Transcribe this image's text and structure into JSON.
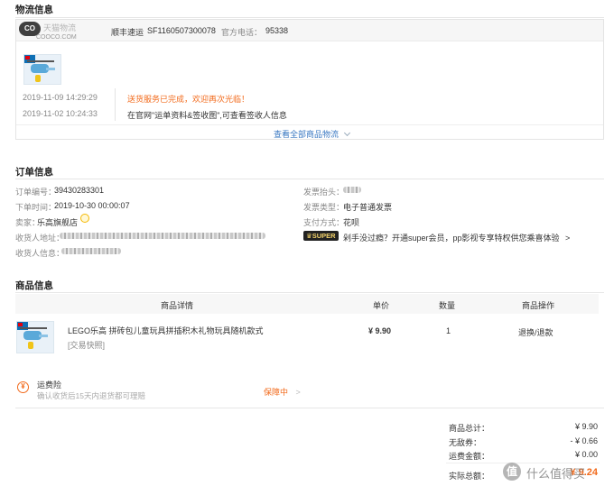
{
  "logistics": {
    "section_title": "物流信息",
    "watermark_logo": "CO",
    "watermark_site": "COOCO.COM",
    "carrier_masked": "天猫物流",
    "carrier": "顺丰速运",
    "tracking_no": "SF1160507300078",
    "phone_label": "官方电话：",
    "phone": "95338",
    "events": [
      {
        "time": "2019-11-09 14:29:29",
        "text": "送货服务已完成，欢迎再次光临！",
        "highlight": true
      },
      {
        "time": "2019-11-02 10:24:33",
        "text": "在官网\"运单资料&签收图\",可查看签收人信息",
        "highlight": false
      }
    ],
    "view_all": "查看全部商品物流",
    "chevron": "chevron-down-icon"
  },
  "order": {
    "section_title": "订单信息",
    "order_no_label": "订单编号：",
    "order_no": "39430283301",
    "order_time_label": "下单时间：",
    "order_time": "2019-10-30 00:00:07",
    "seller_label": "卖家：",
    "seller": "乐高旗舰店",
    "seller_icon": "chat-icon",
    "address_label": "收货人地址：",
    "receiver_label": "收货人信息：",
    "invoice_title_label": "发票抬头：",
    "invoice_type_label": "发票类型：",
    "invoice_type": "电子普通发票",
    "payment_label": "支付方式：",
    "payment": "花呗",
    "super_badge": "SUPER",
    "super_text": "剁手没过瘾？开通super会员，pp影视专享特权供您乘喜体验",
    "super_arrow": ">"
  },
  "products": {
    "section_title": "商品信息",
    "headers": {
      "detail": "商品详情",
      "price": "单价",
      "qty": "数量",
      "action": "商品操作"
    },
    "items": [
      {
        "name": "LEGO乐高 拼砖包儿童玩具拼插积木礼物玩具随机款式",
        "tag": "[交易快照]",
        "price": "¥ 9.90",
        "qty": "1",
        "action": "退换/退款"
      }
    ],
    "insurance": {
      "title": "运费险",
      "desc": "确认收货后15天内退货都可理赔",
      "status": "保障中",
      "arrow": ">",
      "icon": "insurance-icon"
    }
  },
  "summary": {
    "rows": [
      {
        "label": "商品总计：",
        "value": "¥ 9.90"
      },
      {
        "label": "无敌券：",
        "value": "- ¥ 0.66"
      },
      {
        "label": "运费金额：",
        "value": "¥ 0.00"
      }
    ],
    "total_label": "实际总额：",
    "total_value": "¥ 9.24"
  },
  "watermark": {
    "icon": "smzdm-logo-icon",
    "text": "什么值得买"
  },
  "colors": {
    "accent": "#f26b1d",
    "link": "#3a78c2",
    "border": "#e4e4e4"
  }
}
